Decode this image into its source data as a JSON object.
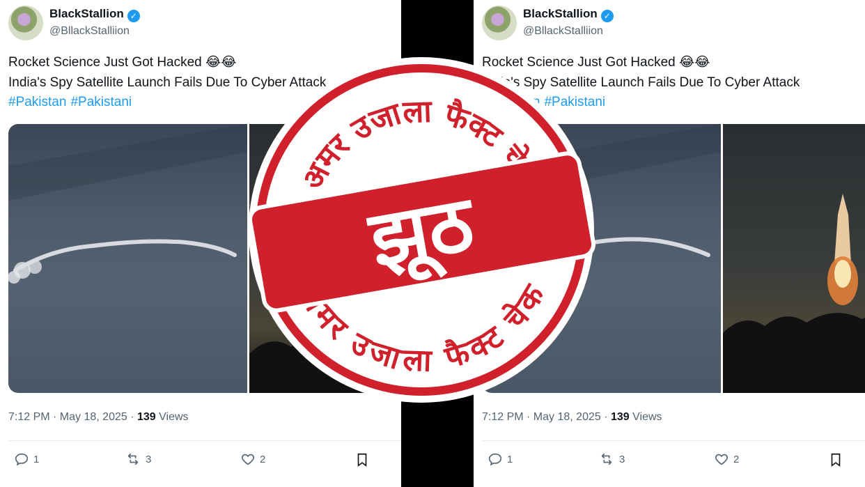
{
  "tweet": {
    "display_name": "BlackStallion",
    "handle": "@BllackStalliion",
    "line1": "Rocket Science Just Got Hacked 😂😂",
    "line2": "India's Spy Satellite Launch Fails Due To Cyber Attack",
    "hashtags": [
      "#Pakistan",
      "#Pakistani"
    ],
    "time": "7:12 PM · May 18, 2025 · ",
    "views_count": "139",
    "views_label": " Views",
    "reply_count": "1",
    "repost_count": "3",
    "like_count": "2"
  },
  "stamp": {
    "top_arc_text": "अमर उजाला फैक्ट चेक",
    "bottom_arc_text": "अमर उजाला फैक्ट चेक",
    "verdict": "झूठ",
    "color": "#d0202b"
  },
  "icons": [
    "verified-badge-icon",
    "reply-icon",
    "repost-icon",
    "like-icon",
    "bookmark-icon"
  ]
}
